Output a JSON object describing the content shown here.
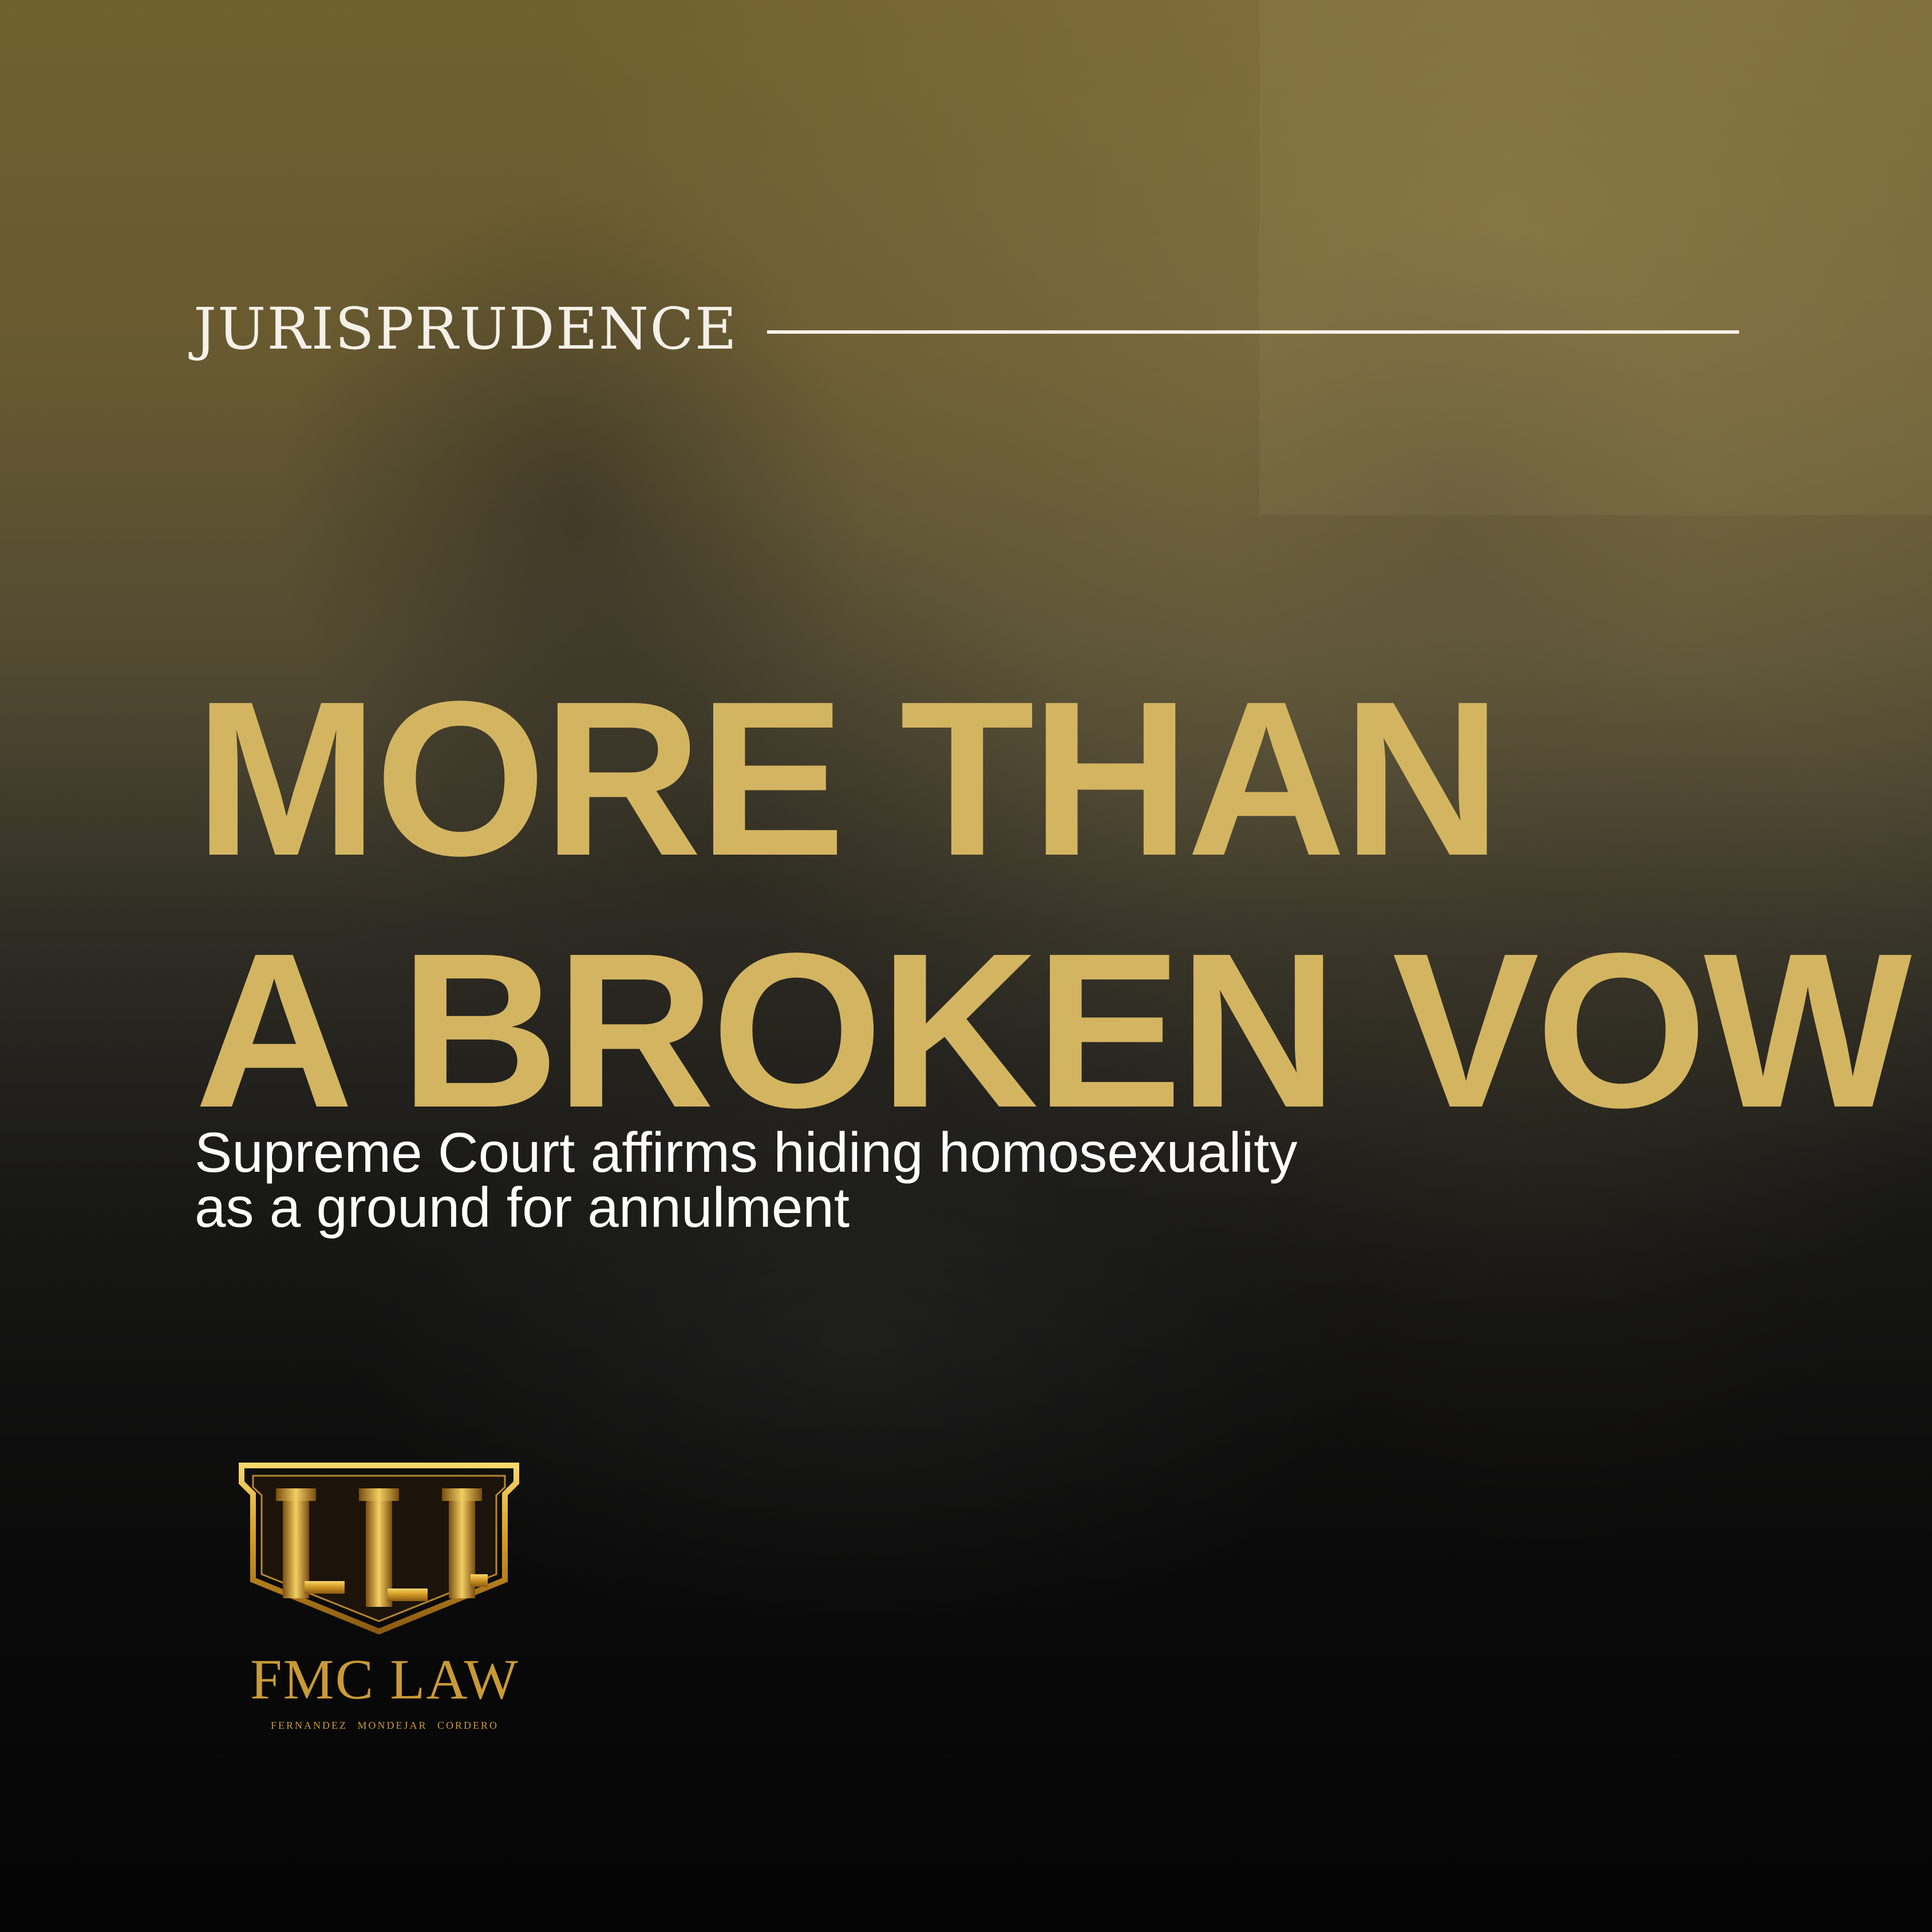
{
  "kicker": "JURISPRUDENCE",
  "headline": {
    "line1": "MORE THAN",
    "line2": "A BROKEN VOW"
  },
  "subhead": {
    "line1": "Supreme Court affirms hiding homosexuality",
    "line2": "as a ground for annulment"
  },
  "brand": {
    "name": "FMC LAW",
    "tagline": "FERNANDEZ  MONDEJAR  CORDERO",
    "logo_icon": "pillars-shield-icon"
  },
  "colors": {
    "headline_gold": "#d3b461",
    "logo_gold": "#c99a35",
    "text_white": "#ffffff",
    "background_dark": "#0c0c0c",
    "background_olive": "#736230"
  }
}
